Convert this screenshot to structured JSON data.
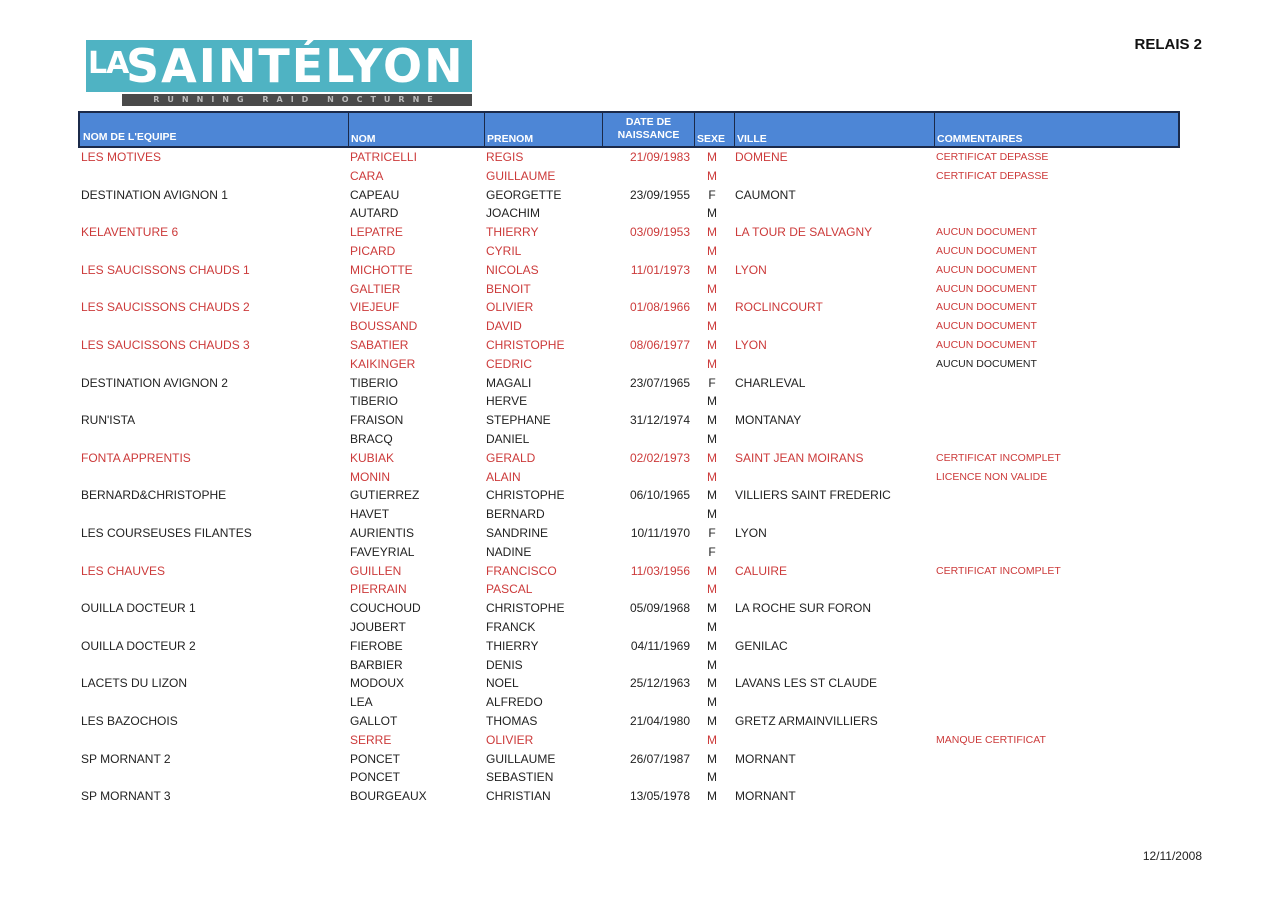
{
  "logo": {
    "prefix": "LA",
    "main": "SAINTÉLYON",
    "tagline": "RUNNING RAID NOCTURNE"
  },
  "relais": "RELAIS 2",
  "headers": {
    "team": "NOM DE L'EQUIPE",
    "nom": "NOM",
    "prenom": "PRENOM",
    "date_line1": "DATE DE",
    "date_line2": "NAISSANCE",
    "sexe": "SEXE",
    "ville": "VILLE",
    "commentaires": "COMMENTAIRES"
  },
  "rows": [
    {
      "team": "LES MOTIVES",
      "nom": "PATRICELLI",
      "prenom": "REGIS",
      "date": "21/09/1983",
      "sexe": "M",
      "ville": "DOMENE",
      "com": "CERTIFICAT DEPASSE",
      "red": true
    },
    {
      "team": "",
      "nom": "CARA",
      "prenom": "GUILLAUME",
      "date": "",
      "sexe": "M",
      "ville": "",
      "com": "CERTIFICAT DEPASSE",
      "red": true
    },
    {
      "team": "DESTINATION AVIGNON 1",
      "nom": "CAPEAU",
      "prenom": "GEORGETTE",
      "date": "23/09/1955",
      "sexe": "F",
      "ville": "CAUMONT",
      "com": "",
      "red": false
    },
    {
      "team": "",
      "nom": "AUTARD",
      "prenom": "JOACHIM",
      "date": "",
      "sexe": "M",
      "ville": "",
      "com": "",
      "red": false
    },
    {
      "team": "KELAVENTURE 6",
      "nom": "LEPATRE",
      "prenom": "THIERRY",
      "date": "03/09/1953",
      "sexe": "M",
      "ville": "LA TOUR DE SALVAGNY",
      "com": "AUCUN DOCUMENT",
      "red": true
    },
    {
      "team": "",
      "nom": "PICARD",
      "prenom": "CYRIL",
      "date": "",
      "sexe": "M",
      "ville": "",
      "com": "AUCUN DOCUMENT",
      "red": true
    },
    {
      "team": "LES SAUCISSONS CHAUDS 1",
      "nom": "MICHOTTE",
      "prenom": "NICOLAS",
      "date": "11/01/1973",
      "sexe": "M",
      "ville": "LYON",
      "com": "AUCUN DOCUMENT",
      "red": true
    },
    {
      "team": "",
      "nom": "GALTIER",
      "prenom": "BENOIT",
      "date": "",
      "sexe": "M",
      "ville": "",
      "com": "AUCUN DOCUMENT",
      "red": true
    },
    {
      "team": "LES SAUCISSONS CHAUDS 2",
      "nom": "VIEJEUF",
      "prenom": "OLIVIER",
      "date": "01/08/1966",
      "sexe": "M",
      "ville": "ROCLINCOURT",
      "com": "AUCUN DOCUMENT",
      "red": true
    },
    {
      "team": "",
      "nom": "BOUSSAND",
      "prenom": "DAVID",
      "date": "",
      "sexe": "M",
      "ville": "",
      "com": "AUCUN DOCUMENT",
      "red": true
    },
    {
      "team": "LES SAUCISSONS CHAUDS 3",
      "nom": "SABATIER",
      "prenom": "CHRISTOPHE",
      "date": "08/06/1977",
      "sexe": "M",
      "ville": "LYON",
      "com": "AUCUN DOCUMENT",
      "red": true
    },
    {
      "team": "",
      "nom": "KAIKINGER",
      "prenom": "CEDRIC",
      "date": "",
      "sexe": "M",
      "ville": "",
      "com": "AUCUN DOCUMENT",
      "red": true,
      "black_com": true
    },
    {
      "team": "DESTINATION AVIGNON 2",
      "nom": "TIBERIO",
      "prenom": "MAGALI",
      "date": "23/07/1965",
      "sexe": "F",
      "ville": "CHARLEVAL",
      "com": "",
      "red": false
    },
    {
      "team": "",
      "nom": "TIBERIO",
      "prenom": "HERVE",
      "date": "",
      "sexe": "M",
      "ville": "",
      "com": "",
      "red": false
    },
    {
      "team": "RUN'ISTA",
      "nom": "FRAISON",
      "prenom": "STEPHANE",
      "date": "31/12/1974",
      "sexe": "M",
      "ville": "MONTANAY",
      "com": "",
      "red": false
    },
    {
      "team": "",
      "nom": "BRACQ",
      "prenom": "DANIEL",
      "date": "",
      "sexe": "M",
      "ville": "",
      "com": "",
      "red": false
    },
    {
      "team": "FONTA APPRENTIS",
      "nom": "KUBIAK",
      "prenom": "GERALD",
      "date": "02/02/1973",
      "sexe": "M",
      "ville": "SAINT JEAN MOIRANS",
      "com": "CERTIFICAT INCOMPLET",
      "red": true
    },
    {
      "team": "",
      "nom": "MONIN",
      "prenom": "ALAIN",
      "date": "",
      "sexe": "M",
      "ville": "",
      "com": "LICENCE NON VALIDE",
      "red": true
    },
    {
      "team": "BERNARD&CHRISTOPHE",
      "nom": "GUTIERREZ",
      "prenom": "CHRISTOPHE",
      "date": "06/10/1965",
      "sexe": "M",
      "ville": "VILLIERS SAINT FREDERIC",
      "com": "",
      "red": false
    },
    {
      "team": "",
      "nom": "HAVET",
      "prenom": "BERNARD",
      "date": "",
      "sexe": "M",
      "ville": "",
      "com": "",
      "red": false
    },
    {
      "team": "LES COURSEUSES FILANTES",
      "nom": "AURIENTIS",
      "prenom": "SANDRINE",
      "date": "10/11/1970",
      "sexe": "F",
      "ville": "LYON",
      "com": "",
      "red": false
    },
    {
      "team": "",
      "nom": "FAVEYRIAL",
      "prenom": "NADINE",
      "date": "",
      "sexe": "F",
      "ville": "",
      "com": "",
      "red": false
    },
    {
      "team": "LES CHAUVES",
      "nom": "GUILLEN",
      "prenom": "FRANCISCO",
      "date": "11/03/1956",
      "sexe": "M",
      "ville": "CALUIRE",
      "com": "CERTIFICAT INCOMPLET",
      "red": true
    },
    {
      "team": "",
      "nom": "PIERRAIN",
      "prenom": "PASCAL",
      "date": "",
      "sexe": "M",
      "ville": "",
      "com": "",
      "red": true
    },
    {
      "team": "OUILLA DOCTEUR 1",
      "nom": "COUCHOUD",
      "prenom": "CHRISTOPHE",
      "date": "05/09/1968",
      "sexe": "M",
      "ville": "LA ROCHE SUR FORON",
      "com": "",
      "red": false
    },
    {
      "team": "",
      "nom": "JOUBERT",
      "prenom": "FRANCK",
      "date": "",
      "sexe": "M",
      "ville": "",
      "com": "",
      "red": false
    },
    {
      "team": "OUILLA DOCTEUR 2",
      "nom": "FIEROBE",
      "prenom": "THIERRY",
      "date": "04/11/1969",
      "sexe": "M",
      "ville": "GENILAC",
      "com": "",
      "red": false
    },
    {
      "team": "",
      "nom": "BARBIER",
      "prenom": "DENIS",
      "date": "",
      "sexe": "M",
      "ville": "",
      "com": "",
      "red": false
    },
    {
      "team": "LACETS DU LIZON",
      "nom": "MODOUX",
      "prenom": "NOEL",
      "date": "25/12/1963",
      "sexe": "M",
      "ville": "LAVANS LES ST CLAUDE",
      "com": "",
      "red": false
    },
    {
      "team": "",
      "nom": "LEA",
      "prenom": "ALFREDO",
      "date": "",
      "sexe": "M",
      "ville": "",
      "com": "",
      "red": false
    },
    {
      "team": "LES BAZOCHOIS",
      "nom": "GALLOT",
      "prenom": "THOMAS",
      "date": "21/04/1980",
      "sexe": "M",
      "ville": "GRETZ ARMAINVILLIERS",
      "com": "",
      "red": false
    },
    {
      "team": "",
      "nom": "SERRE",
      "prenom": "OLIVIER",
      "date": "",
      "sexe": "M",
      "ville": "",
      "com": "MANQUE CERTIFICAT",
      "red": true
    },
    {
      "team": "SP MORNANT 2",
      "nom": "PONCET",
      "prenom": "GUILLAUME",
      "date": "26/07/1987",
      "sexe": "M",
      "ville": "MORNANT",
      "com": "",
      "red": false
    },
    {
      "team": "",
      "nom": "PONCET",
      "prenom": "SEBASTIEN",
      "date": "",
      "sexe": "M",
      "ville": "",
      "com": "",
      "red": false
    },
    {
      "team": "SP MORNANT 3",
      "nom": "BOURGEAUX",
      "prenom": "CHRISTIAN",
      "date": "13/05/1978",
      "sexe": "M",
      "ville": "MORNANT",
      "com": "",
      "red": false
    }
  ],
  "footer_date": "12/11/2008"
}
